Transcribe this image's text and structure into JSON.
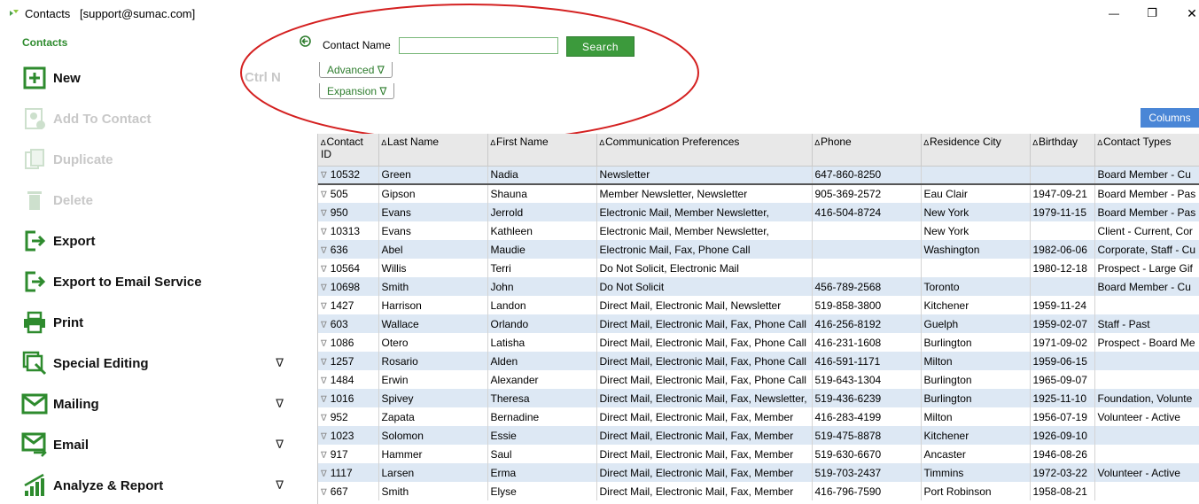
{
  "window": {
    "title": "Contacts",
    "user": "[support@sumac.com]",
    "minimize_glyph": "—",
    "maximize_glyph": "❐",
    "close_glyph": "✕"
  },
  "sidebar": {
    "title": "Contacts",
    "shortcut": "Ctrl N",
    "items": [
      {
        "label": "New",
        "icon": "plus-box-icon",
        "disabled": false
      },
      {
        "label": "Add To Contact",
        "icon": "add-contact-icon",
        "disabled": true
      },
      {
        "label": "Duplicate",
        "icon": "duplicate-icon",
        "disabled": true
      },
      {
        "label": "Delete",
        "icon": "trash-icon",
        "disabled": true
      },
      {
        "label": "Export",
        "icon": "export-icon",
        "disabled": false
      },
      {
        "label": "Export to Email Service",
        "icon": "export-icon",
        "disabled": false
      },
      {
        "label": "Print",
        "icon": "printer-icon",
        "disabled": false
      },
      {
        "label": "Special Editing",
        "icon": "special-editing-icon",
        "disabled": false,
        "expand": "∇"
      },
      {
        "label": "Mailing",
        "icon": "mail-icon",
        "disabled": false,
        "expand": "∇"
      },
      {
        "label": "Email",
        "icon": "email-icon",
        "disabled": false,
        "expand": "∇"
      },
      {
        "label": "Analyze & Report",
        "icon": "bar-chart-icon",
        "disabled": false,
        "expand": "∇"
      }
    ]
  },
  "search": {
    "label": "Contact Name",
    "value": "",
    "button": "Search",
    "advanced": "Advanced ∇",
    "expansion": "Expansion ∇"
  },
  "columns_button": "Columns",
  "table": {
    "sort_glyph": "∆",
    "row_glyph": "∇",
    "headers": [
      "Contact ID",
      "Last Name",
      "First Name",
      "Communication Preferences",
      "Phone",
      "Residence City",
      "Birthday",
      "Contact Types"
    ],
    "rows": [
      [
        "10532",
        "Green",
        "Nadia",
        "Newsletter",
        "647-860-8250",
        "",
        "",
        "Board Member - Cu"
      ],
      [
        "505",
        "Gipson",
        "Shauna",
        "Member Newsletter, Newsletter",
        "905-369-2572",
        "Eau Clair",
        "1947-09-21",
        "Board Member - Pas"
      ],
      [
        "950",
        "Evans",
        "Jerrold",
        "Electronic Mail, Member Newsletter,",
        "416-504-8724",
        "New York",
        "1979-11-15",
        "Board Member - Pas"
      ],
      [
        "10313",
        "Evans",
        "Kathleen",
        "Electronic Mail, Member Newsletter,",
        "",
        "New York",
        "",
        "Client - Current, Cor"
      ],
      [
        "636",
        "Abel",
        "Maudie",
        "Electronic Mail, Fax, Phone Call",
        "",
        "Washington",
        "1982-06-06",
        "Corporate, Staff - Cu"
      ],
      [
        "10564",
        "Willis",
        "Terri",
        "Do Not Solicit, Electronic Mail",
        "",
        "",
        "1980-12-18",
        "Prospect - Large Gif"
      ],
      [
        "10698",
        "Smith",
        "John",
        "Do Not Solicit",
        "456-789-2568",
        "Toronto",
        "",
        "Board Member - Cu"
      ],
      [
        "1427",
        "Harrison",
        "Landon",
        "Direct Mail, Electronic Mail, Newsletter",
        "519-858-3800",
        "Kitchener",
        "1959-11-24",
        ""
      ],
      [
        "603",
        "Wallace",
        "Orlando",
        "Direct Mail, Electronic Mail, Fax, Phone Call",
        "416-256-8192",
        "Guelph",
        "1959-02-07",
        "Staff - Past"
      ],
      [
        "1086",
        "Otero",
        "Latisha",
        "Direct Mail, Electronic Mail, Fax, Phone Call",
        "416-231-1608",
        "Burlington",
        "1971-09-02",
        "Prospect - Board Me"
      ],
      [
        "1257",
        "Rosario",
        "Alden",
        "Direct Mail, Electronic Mail, Fax, Phone Call",
        "416-591-1171",
        "Milton",
        "1959-06-15",
        ""
      ],
      [
        "1484",
        "Erwin",
        "Alexander",
        "Direct Mail, Electronic Mail, Fax, Phone Call",
        "519-643-1304",
        "Burlington",
        "1965-09-07",
        ""
      ],
      [
        "1016",
        "Spivey",
        "Theresa",
        "Direct Mail, Electronic Mail, Fax, Newsletter,",
        "519-436-6239",
        "Burlington",
        "1925-11-10",
        "Foundation, Volunte"
      ],
      [
        "952",
        "Zapata",
        "Bernadine",
        "Direct Mail, Electronic Mail, Fax, Member",
        "416-283-4199",
        "Milton",
        "1956-07-19",
        "Volunteer - Active"
      ],
      [
        "1023",
        "Solomon",
        "Essie",
        "Direct Mail, Electronic Mail, Fax, Member",
        "519-475-8878",
        "Kitchener",
        "1926-09-10",
        ""
      ],
      [
        "917",
        "Hammer",
        "Saul",
        "Direct Mail, Electronic Mail, Fax, Member",
        "519-630-6670",
        "Ancaster",
        "1946-08-26",
        ""
      ],
      [
        "1117",
        "Larsen",
        "Erma",
        "Direct Mail, Electronic Mail, Fax, Member",
        "519-703-2437",
        "Timmins",
        "1972-03-22",
        "Volunteer - Active"
      ],
      [
        "667",
        "Smith",
        "Elyse",
        "Direct Mail, Electronic Mail, Fax, Member",
        "416-796-7590",
        "Port Robinson",
        "1958-08-21",
        ""
      ]
    ]
  },
  "colors": {
    "accent_green": "#3c9a3c",
    "row_alt": "#dde8f4",
    "annotation_red": "#d42020",
    "columns_blue": "#4a86d6"
  }
}
